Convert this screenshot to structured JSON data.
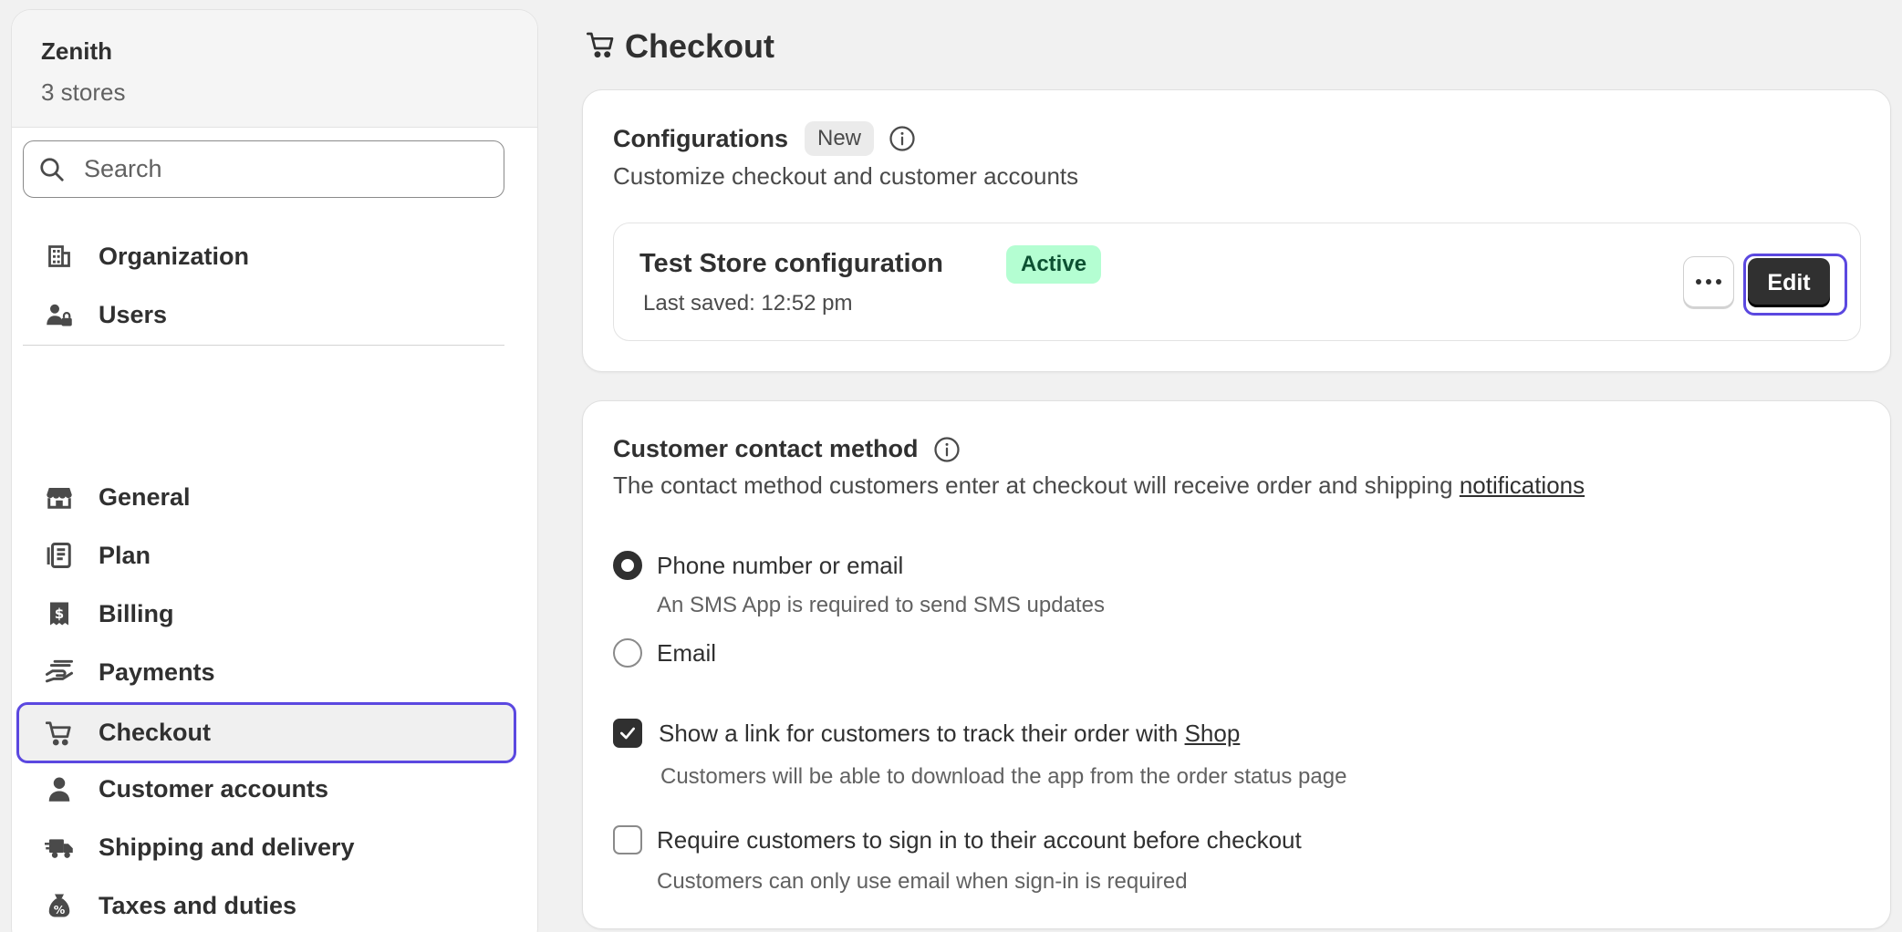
{
  "sidebar": {
    "org_name": "Zenith",
    "org_sub": "3 stores",
    "search_placeholder": "Search",
    "top_items": [
      {
        "label": "Organization",
        "icon": "building-icon"
      },
      {
        "label": "Users",
        "icon": "users-lock-icon"
      }
    ],
    "items": [
      {
        "label": "General",
        "icon": "store-icon"
      },
      {
        "label": "Plan",
        "icon": "plan-icon"
      },
      {
        "label": "Billing",
        "icon": "billing-receipt-icon"
      },
      {
        "label": "Payments",
        "icon": "payments-hand-icon"
      },
      {
        "label": "Checkout",
        "icon": "cart-icon",
        "active": true
      },
      {
        "label": "Customer accounts",
        "icon": "person-icon"
      },
      {
        "label": "Shipping and delivery",
        "icon": "truck-icon"
      },
      {
        "label": "Taxes and duties",
        "icon": "tax-bag-icon"
      }
    ]
  },
  "header": {
    "title": "Checkout",
    "icon": "cart-icon"
  },
  "configurations": {
    "title": "Configurations",
    "badge": "New",
    "description": "Customize checkout and customer accounts",
    "config": {
      "name": "Test Store configuration",
      "status": "Active",
      "last_saved": "Last saved: 12:52 pm",
      "edit_label": "Edit"
    }
  },
  "contact": {
    "title": "Customer contact method",
    "description": "The contact method customers enter at checkout will receive order and shipping",
    "description_link": "notifications",
    "options": [
      {
        "label": "Phone number or email",
        "help": "An SMS App is required to send SMS updates",
        "selected": true
      },
      {
        "label": "Email",
        "help": "",
        "selected": false
      }
    ],
    "track": {
      "label": "Show a link for customers to track their order with",
      "link": "Shop",
      "help": "Customers will be able to download the app from the order status page",
      "checked": true
    },
    "signin": {
      "label": "Require customers to sign in to their account before checkout",
      "help": "Customers can only use email when sign-in is required",
      "checked": false
    }
  },
  "colors": {
    "accent": "#5b48e0",
    "active_badge_bg": "#b4fed2",
    "active_badge_text": "#0c5132",
    "primary_button": "#303030"
  }
}
